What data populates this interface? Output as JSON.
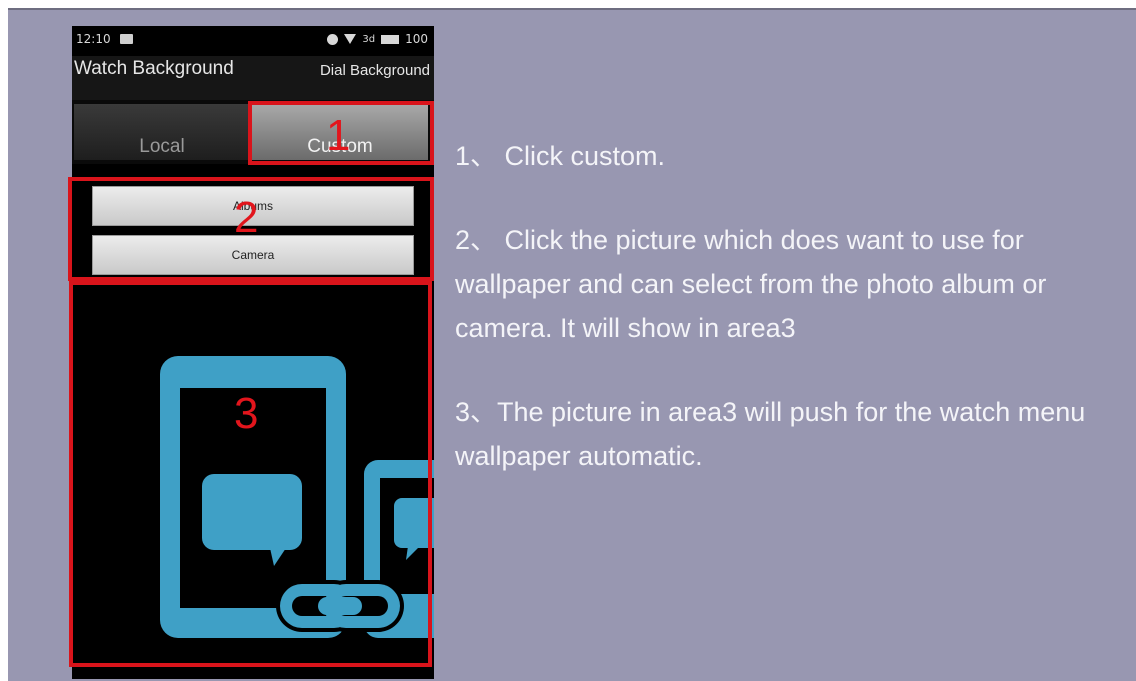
{
  "phone": {
    "status": {
      "time": "12:10",
      "battery": "100"
    },
    "appbar": {
      "title": "Watch Background",
      "action": "Dial Background"
    },
    "tabs": [
      {
        "label": "Local"
      },
      {
        "label": "Custom"
      }
    ],
    "buttons": {
      "albums": "Albums",
      "camera": "Camera"
    }
  },
  "annotations": {
    "n1": "1",
    "n2": "2",
    "n3": "3"
  },
  "instructions": [
    "1、 Click custom.",
    "2、 Click the picture which does want to use for wallpaper and can select from the photo album or camera. It will show in area3",
    "3、The picture in area3 will push for the watch menu wallpaper automatic."
  ],
  "colors": {
    "background": "#9897b1",
    "highlight": "#d9141b",
    "illustration": "#3fa0c6"
  }
}
